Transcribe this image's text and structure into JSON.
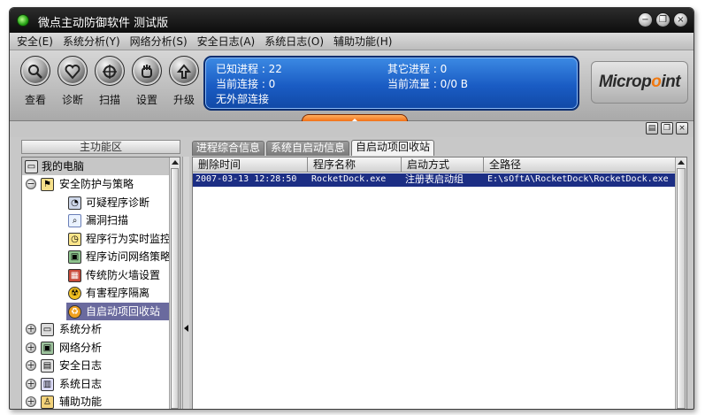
{
  "window": {
    "title": "微点主动防御软件  测试版"
  },
  "title_buttons": {
    "minimize": "−",
    "restore": "❐",
    "close": "×"
  },
  "menu": [
    "安全(E)",
    "系统分析(Y)",
    "网络分析(S)",
    "安全日志(A)",
    "系统日志(O)",
    "辅助功能(H)"
  ],
  "toolbar": {
    "buttons": [
      "查看",
      "诊断",
      "扫描",
      "设置",
      "升级"
    ]
  },
  "status": {
    "known_processes": "已知进程 : 22",
    "other_processes": "其它进程 : 0",
    "current_connections": "当前连接 : 0",
    "current_traffic": "当前流量 : 0/0 B",
    "external_connections": "无外部连接"
  },
  "brand": {
    "logo_text_before": "Microp",
    "logo_text_o": "o",
    "logo_text_after": "int"
  },
  "left_panel": {
    "header": "主功能区",
    "tree": {
      "root": "我的电脑",
      "group_security": "安全防护与策略",
      "items": [
        "可疑程序诊断",
        "漏洞扫描",
        "程序行为实时监控策",
        "程序访问网络策略",
        "传统防火墙设置",
        "有害程序隔离",
        "自启动项回收站"
      ],
      "groups": [
        "系统分析",
        "网络分析",
        "安全日志",
        "系统日志",
        "辅助功能"
      ]
    }
  },
  "tabs": [
    "进程综合信息",
    "系统自启动信息",
    "自启动项回收站"
  ],
  "list": {
    "columns": [
      "删除时间",
      "程序名称",
      "启动方式",
      "全路径"
    ],
    "rows": [
      {
        "time": "2007-03-13 12:28:50",
        "name": "RocketDock.exe",
        "startup": "注册表启动组",
        "path": "E:\\sOftA\\RocketDock\\RocketDock.exe"
      }
    ]
  },
  "colors": {
    "status_panel": "#1a5cc4",
    "selection": "#1c2e84",
    "tree_selection": "#6a6a9e",
    "accent_orange": "#f06a10"
  }
}
